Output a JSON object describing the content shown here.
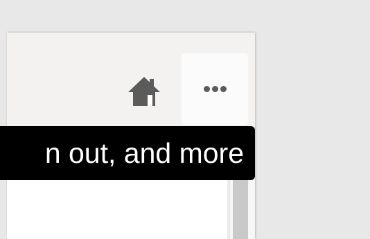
{
  "toolbar": {
    "home_icon": "home-icon",
    "more_icon": "more-horizontal-icon"
  },
  "tooltip": {
    "text": "n out, and more"
  },
  "colors": {
    "background": "#e8e8e8",
    "toolbar": "#f3f2f1",
    "icon": "#5b5b5b",
    "tooltip_bg": "#000000",
    "tooltip_text": "#ffffff",
    "scrollbar_thumb": "#c9c9c9"
  }
}
